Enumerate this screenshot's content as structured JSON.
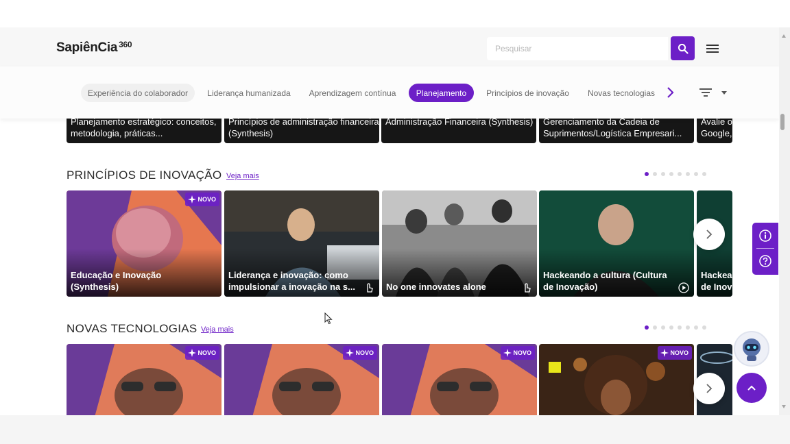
{
  "header": {
    "logo_text": "SapiênCia",
    "logo_suffix": "360",
    "search_placeholder": "Pesquisar",
    "search_icon": "search-icon",
    "menu_icon": "hamburger-menu-icon"
  },
  "tabs": [
    {
      "label": "Experiência do colaborador",
      "active": false
    },
    {
      "label": "Liderança humanizada",
      "active": false
    },
    {
      "label": "Aprendizagem contínua",
      "active": false
    },
    {
      "label": "Planejamento",
      "active": true
    },
    {
      "label": "Princípios de inovação",
      "active": false
    },
    {
      "label": "Novas tecnologias",
      "active": false
    }
  ],
  "prev_row": [
    "Planejamento estratégico: conceitos, metodologia, práticas...",
    "Princípios de administração financeira (Synthesis)",
    "Administração Financeira (Synthesis)",
    "Gerenciamento da Cadeia de Suprimentos/Logística Empresari...",
    "Avalie o Google,"
  ],
  "sections": {
    "innovation": {
      "title": "PRINCÍPIOS DE INOVAÇÃO",
      "more_label": "Veja mais",
      "cards": [
        {
          "title": "Educação e Inovação (Synthesis)",
          "badge": "NOVO",
          "icon": "none"
        },
        {
          "title": "Liderança e inovação: como impulsionar a inovação na s...",
          "badge": "",
          "icon": "touch-icon"
        },
        {
          "title": "No one innovates alone",
          "badge": "",
          "icon": "touch-icon"
        },
        {
          "title": "Hackeando a cultura (Cultura de Inovação)",
          "badge": "",
          "icon": "play-icon"
        },
        {
          "title": "Hackea de Inov",
          "badge": "",
          "icon": "none"
        }
      ]
    },
    "technologies": {
      "title": "NOVAS TECNOLOGIAS",
      "more_label": "Veja mais",
      "cards": [
        {
          "badge": "NOVO"
        },
        {
          "badge": "NOVO"
        },
        {
          "badge": "NOVO"
        },
        {
          "badge": "NOVO"
        },
        {
          "badge": ""
        }
      ]
    }
  },
  "colors": {
    "accent": "#6c1fc7",
    "header_bg": "#f7f7f7"
  }
}
